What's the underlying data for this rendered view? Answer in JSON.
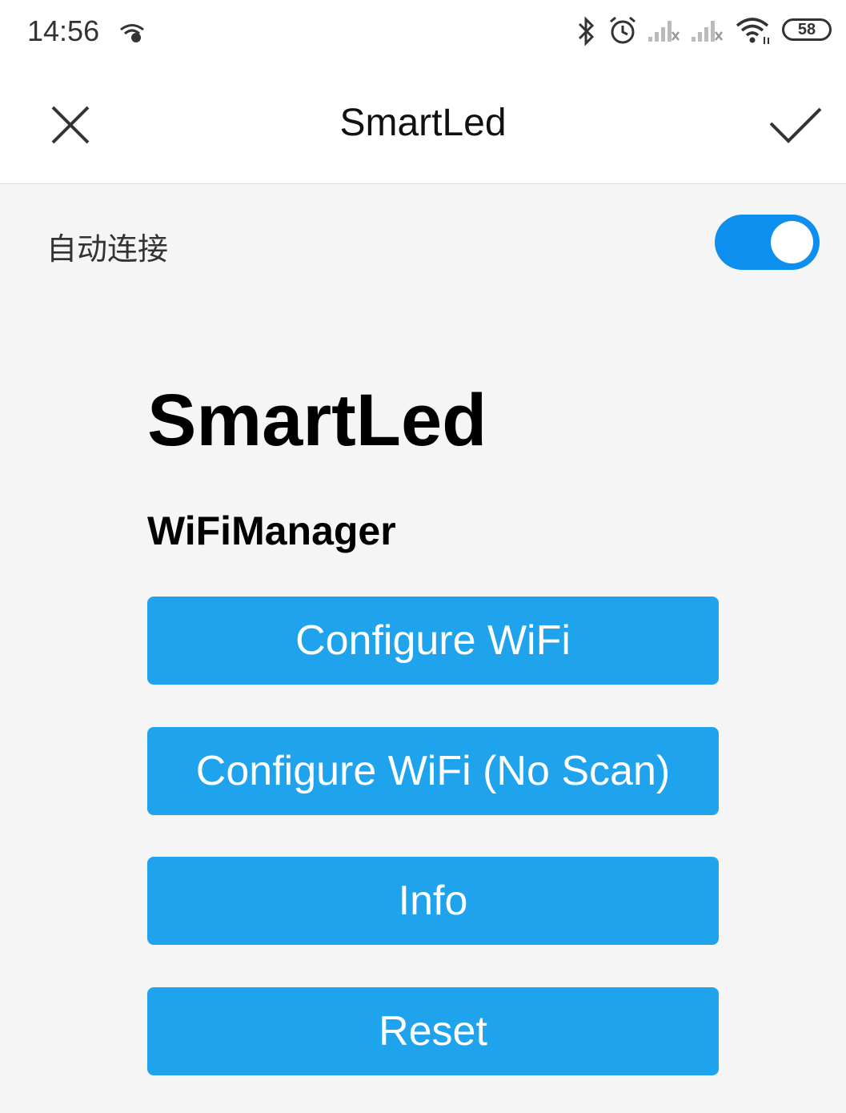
{
  "status_bar": {
    "time": "14:56",
    "battery": "58",
    "icons": [
      "wifi-status-icon",
      "bluetooth-icon",
      "alarm-icon",
      "signal-icon",
      "signal-icon",
      "wifi-icon",
      "battery-icon"
    ]
  },
  "top_bar": {
    "title": "SmartLed",
    "close_icon": "close-icon",
    "confirm_icon": "check-icon"
  },
  "auto_connect": {
    "label": "自动连接",
    "enabled": true,
    "accent": "#0d8ff0"
  },
  "page": {
    "heading": "SmartLed",
    "subheading": "WiFiManager",
    "button_color": "#1fa3ec",
    "buttons": [
      {
        "label": "Configure WiFi"
      },
      {
        "label": "Configure WiFi (No Scan)"
      },
      {
        "label": "Info"
      },
      {
        "label": "Reset"
      }
    ]
  }
}
